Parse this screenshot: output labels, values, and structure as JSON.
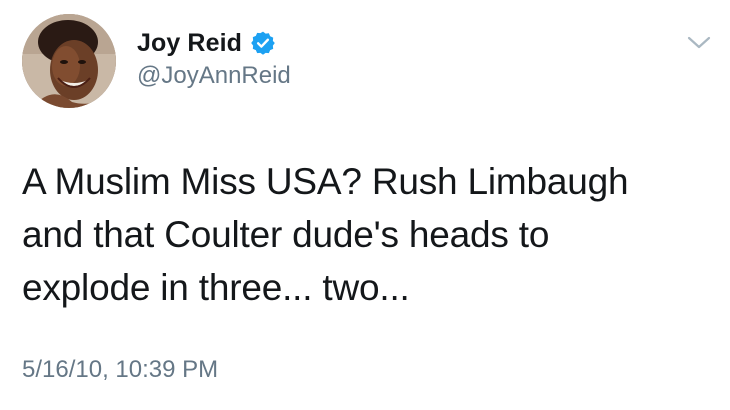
{
  "author": {
    "display_name": "Joy Reid",
    "handle": "@JoyAnnReid",
    "verified": true,
    "avatar_icon": "profile-photo"
  },
  "tweet": {
    "lines": [
      "A Muslim Miss USA? Rush Limbaugh",
      "and that Coulter dude's heads to",
      "explode in three... two..."
    ],
    "timestamp": "5/16/10, 10:39 PM"
  },
  "menu": {
    "icon": "chevron-down-icon"
  },
  "colors": {
    "text": "#14171a",
    "secondary": "#657786",
    "verified_badge": "#1da1f2",
    "chevron": "#aab8c2"
  }
}
